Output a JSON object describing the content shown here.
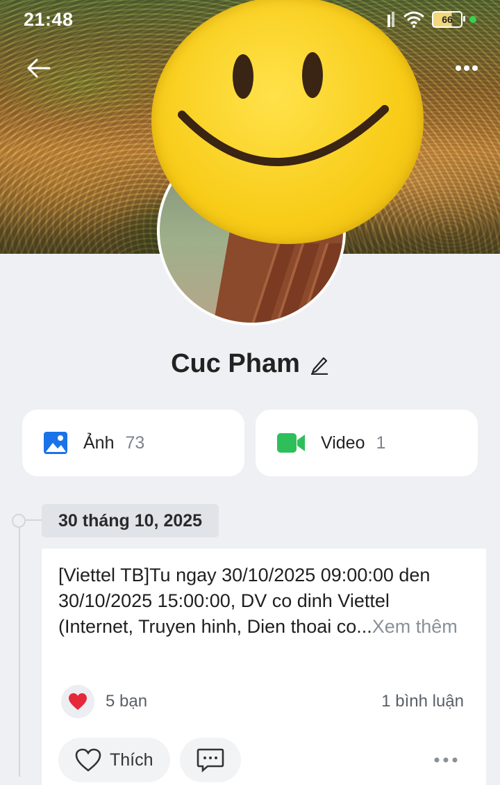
{
  "status_bar": {
    "time": "21:48",
    "battery": "66"
  },
  "profile": {
    "name": "Cuc Pham"
  },
  "media": {
    "photos": {
      "label": "Ảnh",
      "count": "73"
    },
    "videos": {
      "label": "Video",
      "count": "1"
    }
  },
  "timeline": {
    "date": "30 tháng 10, 2025",
    "post": {
      "text": "[Viettel TB]Tu ngay 30/10/2025 09:00:00 den 30/10/2025 15:00:00, DV co dinh Viettel (Internet, Truyen hinh, Dien thoai co...",
      "see_more": "Xem thêm",
      "reactions": "5 bạn",
      "comments": "1 bình luận",
      "like_label": "Thích"
    }
  },
  "colors": {
    "photo_icon": "#1a73e8",
    "video_icon": "#2fbf5a",
    "heart": "#e5283a",
    "smiley": "#f8cc18"
  }
}
